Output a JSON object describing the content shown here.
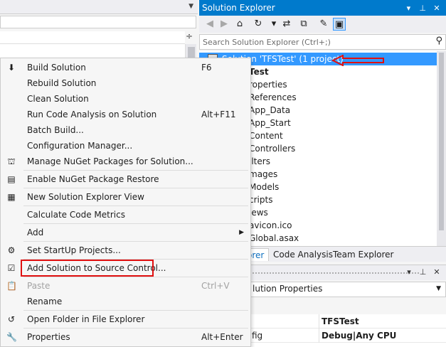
{
  "solution_explorer": {
    "title": "Solution Explorer",
    "search_placeholder": "Search Solution Explorer (Ctrl+;)",
    "tree": [
      {
        "label": "Solution 'TFSTest' (1 project)",
        "selected": true
      },
      {
        "label": "Test",
        "bold": true
      },
      {
        "label": "roperties"
      },
      {
        "label": "References"
      },
      {
        "label": "App_Data"
      },
      {
        "label": "App_Start"
      },
      {
        "label": "Content"
      },
      {
        "label": "Controllers"
      },
      {
        "label": "ilters"
      },
      {
        "label": "mages"
      },
      {
        "label": "Models"
      },
      {
        "label": "cripts"
      },
      {
        "label": "iews"
      },
      {
        "label": "avicon.ico"
      },
      {
        "label": "Global.asax"
      }
    ],
    "tabs": [
      "orer",
      "Code Analysis",
      "Team Explorer"
    ]
  },
  "properties": {
    "object_label": "lution Properties",
    "rows": [
      {
        "name": "",
        "value": "TFSTest"
      },
      {
        "name": "fig",
        "value": "Debug|Any CPU"
      }
    ]
  },
  "context_menu": {
    "items": [
      {
        "label": "Build Solution",
        "shortcut": "F6",
        "icon": "build-icon"
      },
      {
        "label": "Rebuild Solution"
      },
      {
        "label": "Clean Solution"
      },
      {
        "label": "Run Code Analysis on Solution",
        "shortcut": "Alt+F11"
      },
      {
        "label": "Batch Build..."
      },
      {
        "label": "Configuration Manager..."
      },
      {
        "label": "Manage NuGet Packages for Solution...",
        "icon": "nuget-icon"
      },
      {
        "label": "Enable NuGet Package Restore",
        "icon": "package-restore-icon"
      },
      {
        "label": "New Solution Explorer View",
        "icon": "new-view-icon"
      },
      {
        "label": "Calculate Code Metrics"
      },
      {
        "label": "Add",
        "submenu": true
      },
      {
        "label": "Set StartUp Projects...",
        "icon": "gear-icon"
      },
      {
        "label": "Add Solution to Source Control...",
        "icon": "source-control-icon",
        "highlighted": true
      },
      {
        "label": "Paste",
        "shortcut": "Ctrl+V",
        "disabled": true,
        "icon": "paste-icon"
      },
      {
        "label": "Rename"
      },
      {
        "label": "Open Folder in File Explorer",
        "icon": "folder-refresh-icon"
      },
      {
        "label": "Properties",
        "shortcut": "Alt+Enter",
        "icon": "wrench-icon"
      }
    ]
  },
  "colors": {
    "accent": "#007acc",
    "selection": "#3399ff",
    "highlight_border": "#e01010"
  }
}
